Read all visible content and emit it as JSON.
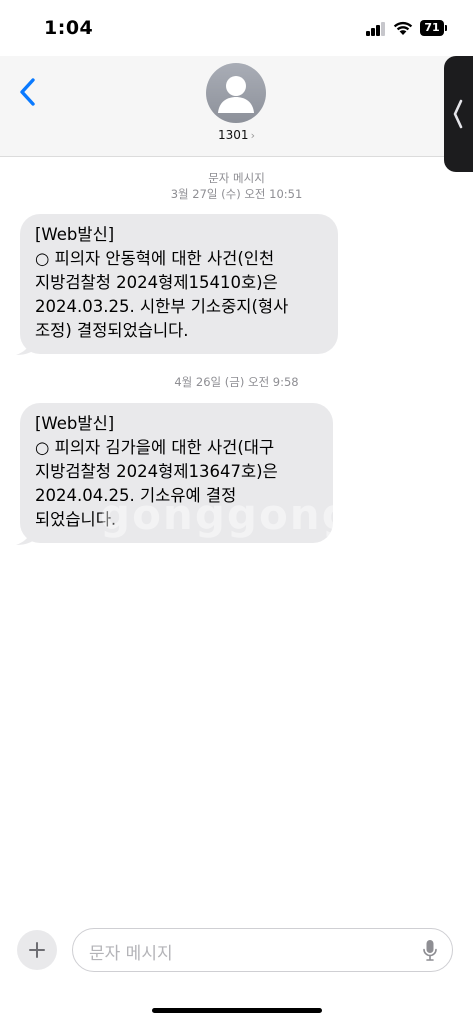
{
  "status": {
    "time": "1:04",
    "battery": "71"
  },
  "header": {
    "contact_name": "1301",
    "chevron": "›"
  },
  "messages": [
    {
      "date_label": "문자 메시지",
      "time_label": "3월 27일 (수) 오전 10:51",
      "lines": [
        "[Web발신]",
        "○ 피의자 안동혁에 대한 사건(인천",
        "지방검찰청 2024형제15410호)은",
        "2024.03.25. 시한부 기소중지(형사",
        "조정) 결정되었습니다."
      ]
    },
    {
      "time_label": "4월 26일 (금) 오전 9:58",
      "lines": [
        "[Web발신]",
        "○ 피의자 김가을에 대한 사건(대구",
        "지방검찰청 2024형제13647호)은",
        "2024.04.25. 기소유예 결정",
        "되었습니다."
      ]
    }
  ],
  "watermark": "gonggong",
  "composer": {
    "placeholder": "문자 메시지"
  },
  "icons": {
    "back": "chevron-left-icon",
    "avatar": "person-icon",
    "plus": "plus-icon",
    "mic": "microphone-icon",
    "signal": "cellular-signal-icon",
    "wifi": "wifi-icon",
    "battery": "battery-icon",
    "side_handle": "chevron-left-icon"
  },
  "colors": {
    "accent": "#0a7aff",
    "bubble": "#e9e9eb",
    "timestamp": "#8e8e93"
  }
}
